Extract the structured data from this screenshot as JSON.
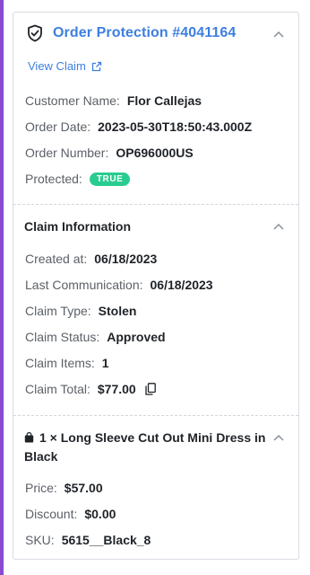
{
  "order": {
    "title": "Order Protection #4041164",
    "view_claim_label": "View Claim",
    "fields": [
      {
        "label": "Customer Name:",
        "value": "Flor Callejas"
      },
      {
        "label": "Order Date:",
        "value": "2023-05-30T18:50:43.000Z"
      },
      {
        "label": "Order Number:",
        "value": "OP696000US"
      }
    ],
    "protected_label": "Protected:",
    "protected_badge": "TRUE"
  },
  "claim": {
    "title": "Claim Information",
    "fields": [
      {
        "label": "Created at:",
        "value": "06/18/2023"
      },
      {
        "label": "Last Communication:",
        "value": "06/18/2023"
      },
      {
        "label": "Claim Type:",
        "value": "Stolen"
      },
      {
        "label": "Claim Status:",
        "value": "Approved"
      },
      {
        "label": "Claim Items:",
        "value": "1"
      },
      {
        "label": "Claim Total:",
        "value": "$77.00"
      }
    ]
  },
  "item": {
    "title": "1 × Long Sleeve Cut Out Mini Dress in Black",
    "fields": [
      {
        "label": "Price:",
        "value": "$57.00"
      },
      {
        "label": "Discount:",
        "value": "$0.00"
      },
      {
        "label": "SKU:",
        "value": "5615__Black_8"
      }
    ]
  },
  "colors": {
    "accent": "#8a4bd1",
    "link": "#3d7fe0",
    "badge": "#29cc8f"
  },
  "icons": [
    "shield-icon",
    "external-link-icon",
    "chevron-up-icon",
    "copy-icon",
    "shopping-bag-icon"
  ]
}
